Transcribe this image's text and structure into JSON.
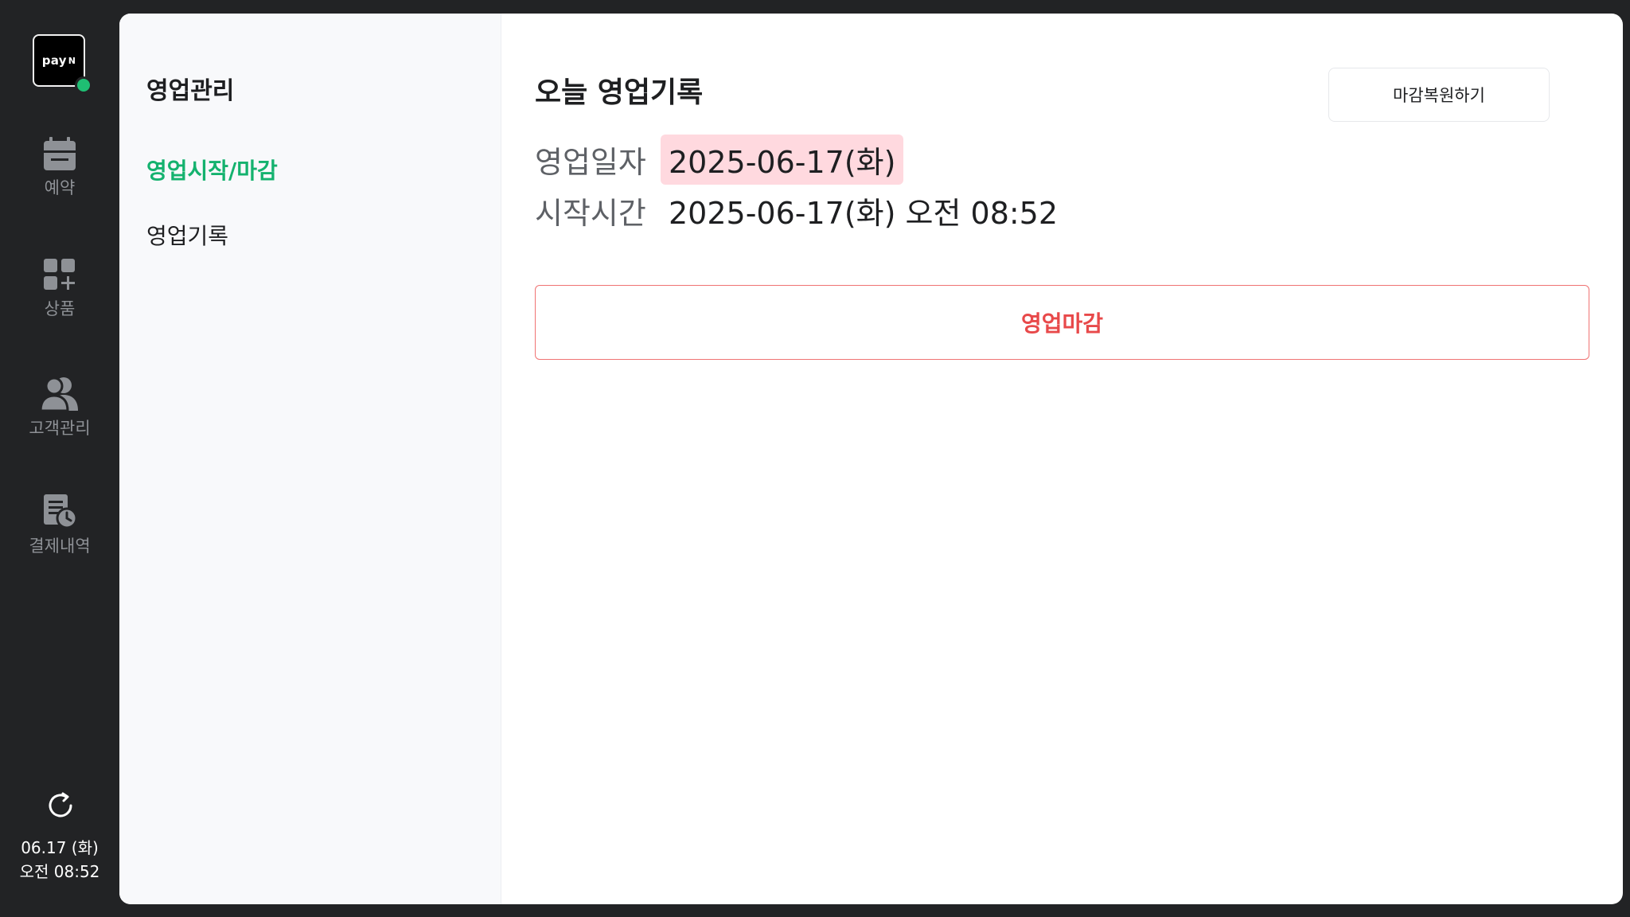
{
  "brand": {
    "logo_text": "pay",
    "logo_mark": "N",
    "status_color": "#1fbe73"
  },
  "rail": {
    "items": [
      {
        "label": "예약",
        "icon": "calendar-icon"
      },
      {
        "label": "상품",
        "icon": "product-grid-icon"
      },
      {
        "label": "고객관리",
        "icon": "customers-icon"
      },
      {
        "label": "결제내역",
        "icon": "receipt-clock-icon"
      }
    ],
    "refresh_icon": "refresh-icon",
    "clock": {
      "date": "06.17 (화)",
      "time": "오전 08:52"
    }
  },
  "submenu": {
    "title": "영업관리",
    "items": [
      {
        "label": "영업시작/마감",
        "active": true
      },
      {
        "label": "영업기록",
        "active": false
      }
    ]
  },
  "main": {
    "title": "오늘 영업기록",
    "restore_button": "마감복원하기",
    "fields": [
      {
        "key": "영업일자",
        "value": "2025-06-17(화)"
      },
      {
        "key": "시작시간",
        "value": "2025-06-17(화) 오전 08:52"
      }
    ],
    "close_button": "영업마감"
  },
  "colors": {
    "accent_green": "#14b26e",
    "danger_red": "#e8494a",
    "highlight_pink": "#ffd9df",
    "rail_bg": "#222325"
  }
}
